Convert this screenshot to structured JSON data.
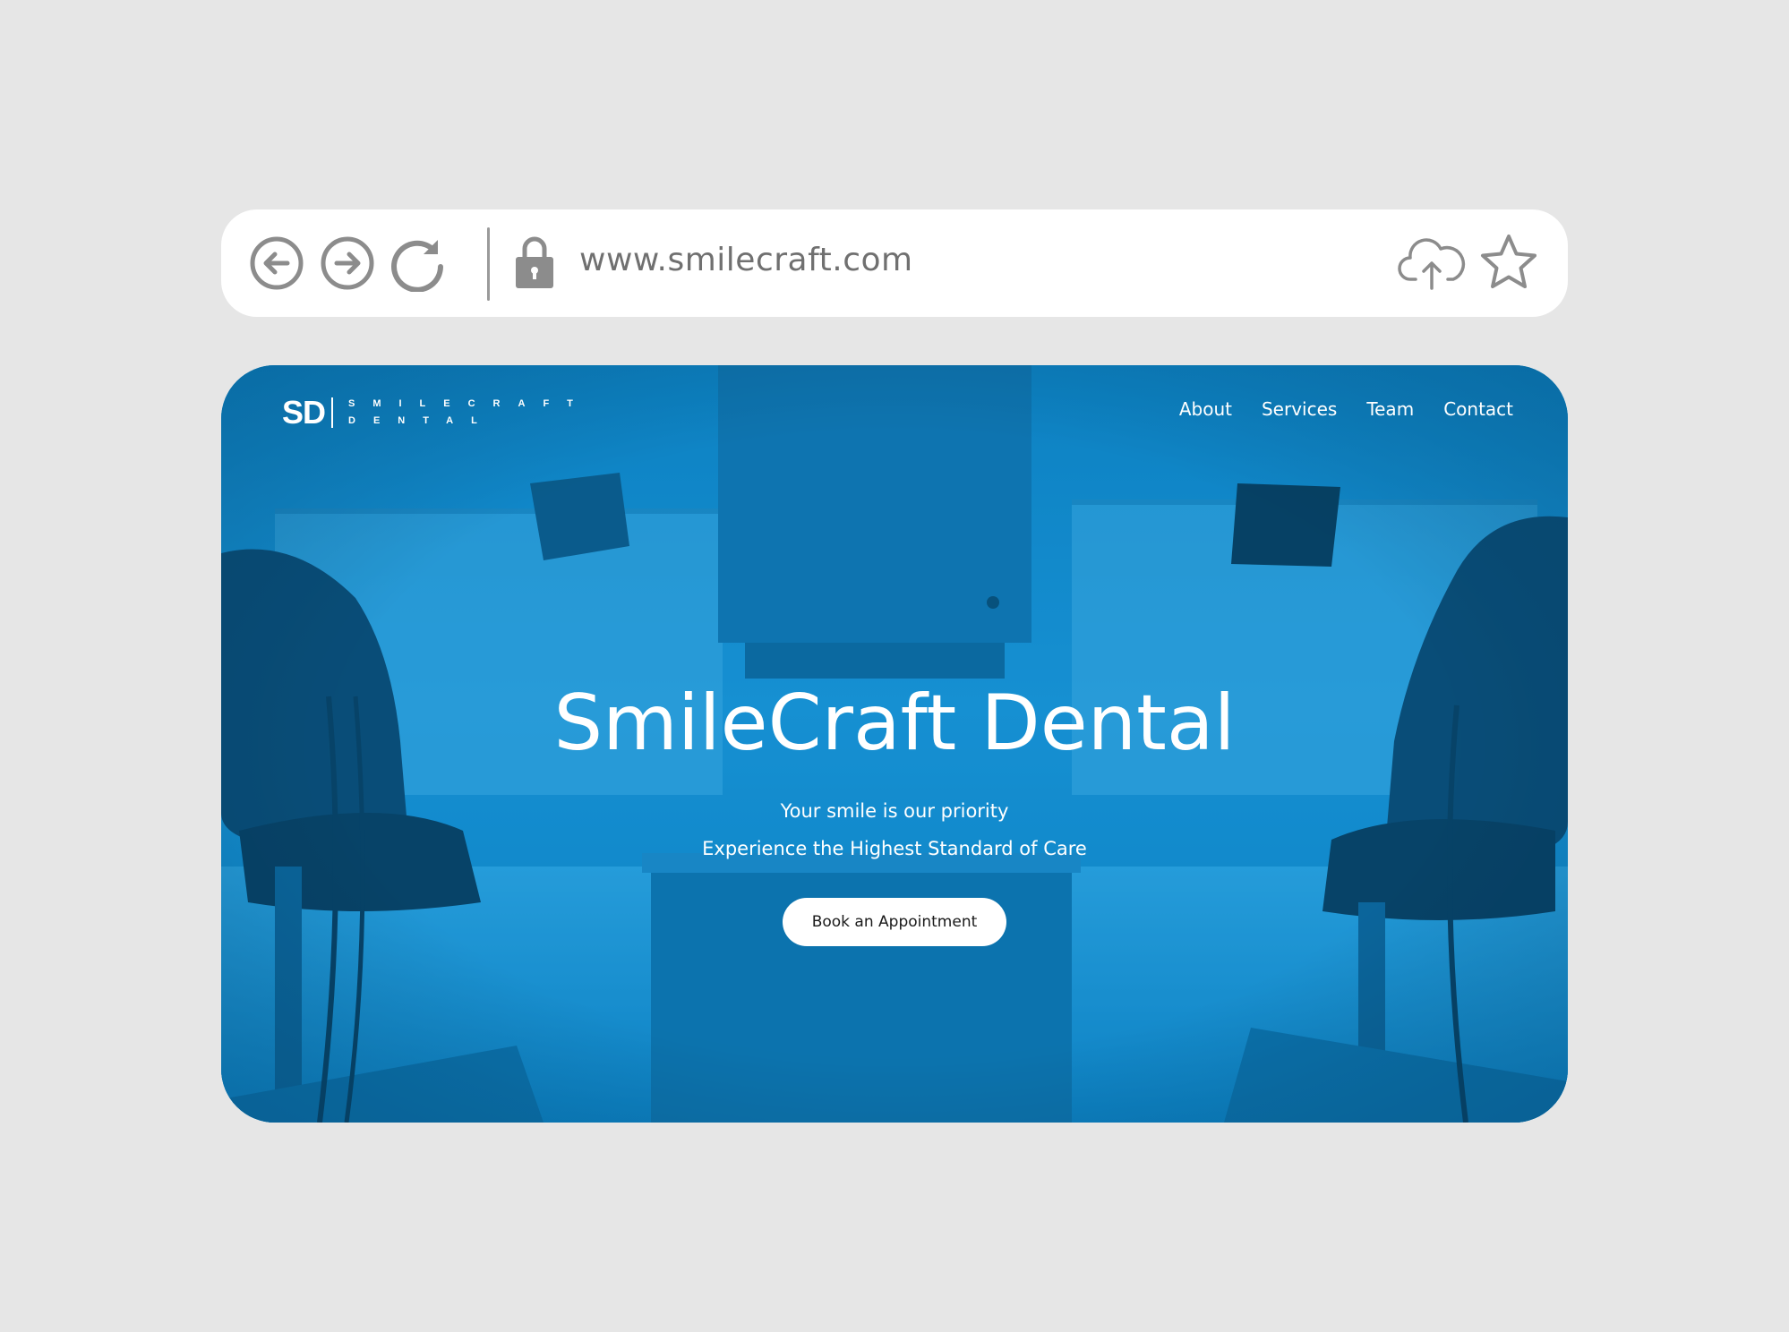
{
  "browser": {
    "url": "www.smilecraft.com",
    "icons": [
      "back-icon",
      "forward-icon",
      "reload-icon",
      "lock-icon",
      "cloud-upload-icon",
      "star-icon"
    ]
  },
  "site": {
    "logo": {
      "mark": "SD",
      "line1": "SMILECRAFT",
      "line2": "DENTAL"
    },
    "nav": [
      {
        "label": "About"
      },
      {
        "label": "Services"
      },
      {
        "label": "Team"
      },
      {
        "label": "Contact"
      }
    ],
    "hero": {
      "title": "SmileCraft Dental",
      "subtitle1": "Your smile is our priority",
      "subtitle2": "Experience the Highest Standard of Care",
      "cta_label": "Book an Appointment"
    }
  },
  "colors": {
    "page_background": "#e6e6e6",
    "hero_blue": "#0a86c9",
    "icon_gray": "#8c8c8c"
  }
}
